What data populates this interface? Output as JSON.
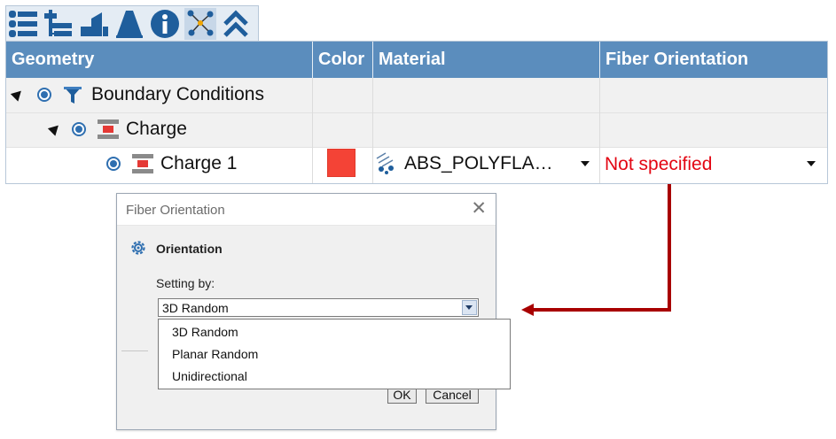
{
  "toolbar": {
    "buttons": [
      {
        "icon": "list-icon"
      },
      {
        "icon": "tree-icon"
      },
      {
        "icon": "stairs-icon"
      },
      {
        "icon": "cone-icon"
      },
      {
        "icon": "info-icon"
      },
      {
        "icon": "network-icon",
        "active": true
      },
      {
        "icon": "collapse-up-icon"
      }
    ]
  },
  "grid": {
    "columns": [
      "Geometry",
      "Color",
      "Material",
      "Fiber Orientation"
    ],
    "rows": [
      {
        "label": "Boundary Conditions",
        "icon": "funnel-icon",
        "expanded": true
      },
      {
        "label": "Charge",
        "icon": "charge-group-icon",
        "expanded": true
      },
      {
        "label": "Charge 1",
        "icon": "charge-icon",
        "color": "#f44336",
        "material": "ABS_POLYFLA…",
        "fiber_orientation": "Not specified"
      }
    ]
  },
  "dialog": {
    "title": "Fiber Orientation",
    "close_label": "✕",
    "section_title": "Orientation",
    "setting_label": "Setting by:",
    "selected_value": "3D Random",
    "options": [
      "3D Random",
      "Planar Random",
      "Unidirectional"
    ],
    "ok_label": "OK",
    "cancel_label": "Cancel"
  },
  "colors": {
    "header_bg": "#5b8dbd",
    "accent": "#2f6fb0",
    "fiber_text": "#e30613",
    "arrow": "#a80000"
  }
}
